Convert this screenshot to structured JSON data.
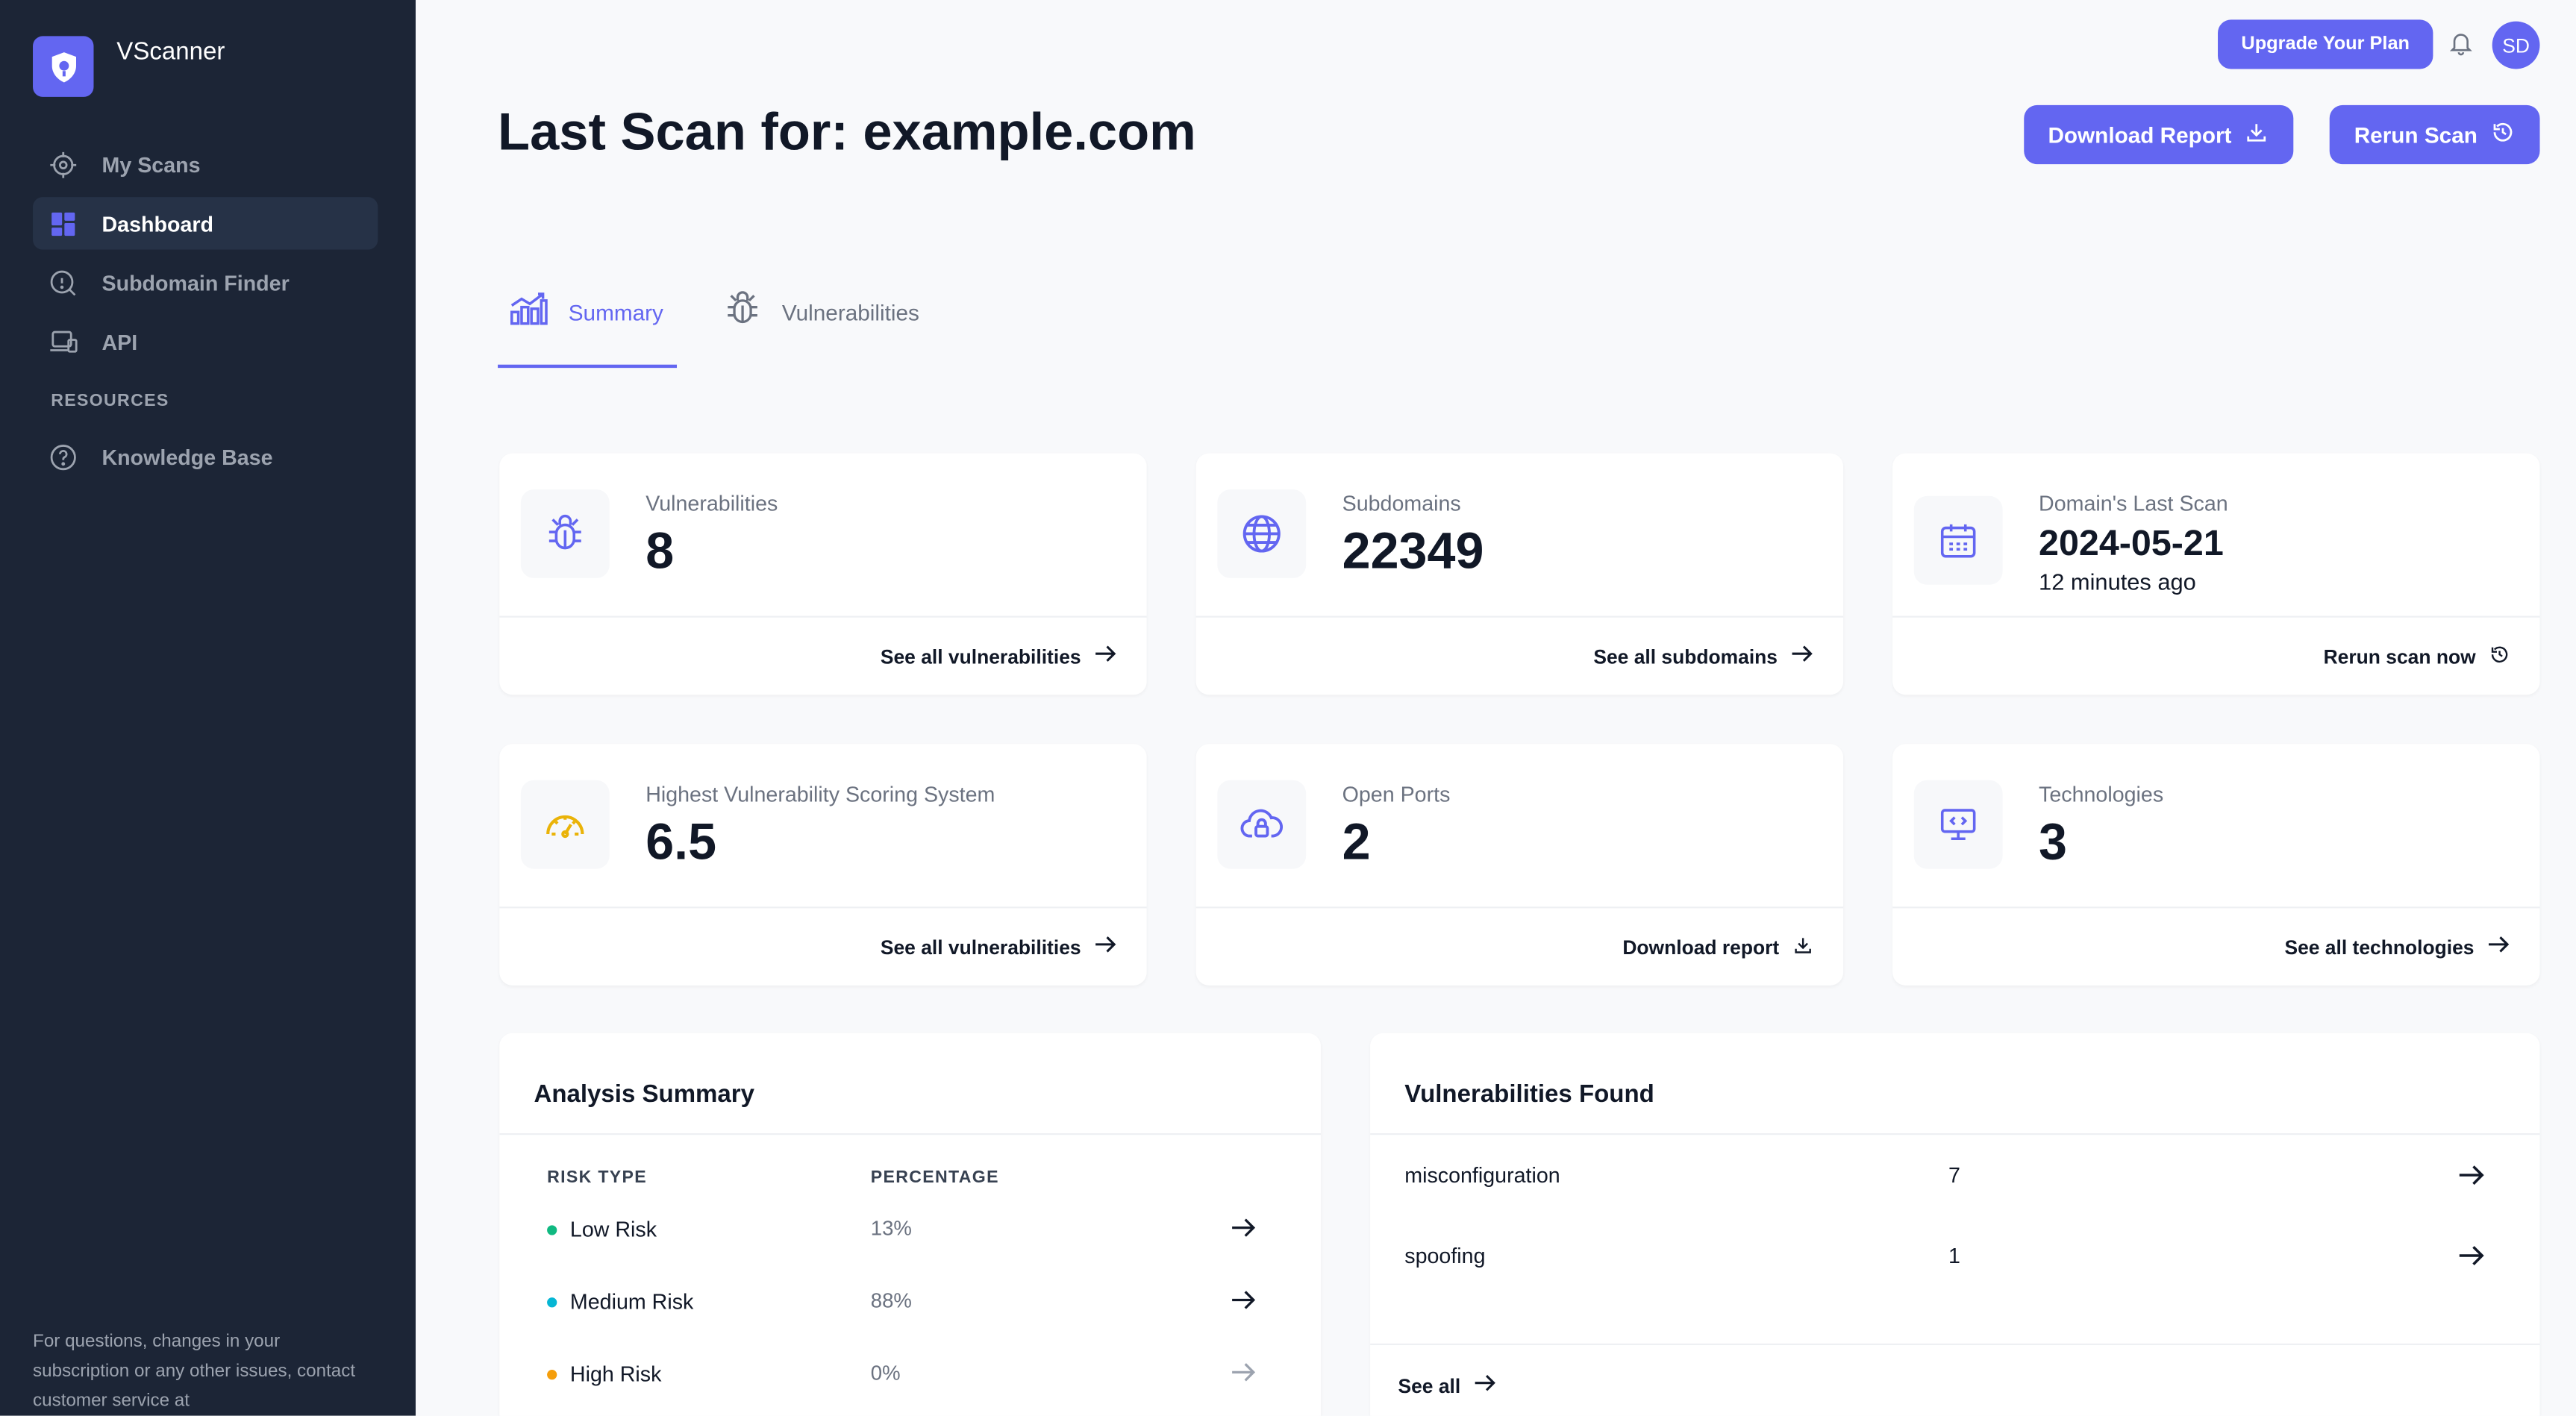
{
  "app": {
    "name": "VScanner"
  },
  "sidebar": {
    "items": [
      {
        "label": "My Scans",
        "icon": "crosshair-icon"
      },
      {
        "label": "Dashboard",
        "icon": "grid-icon"
      },
      {
        "label": "Subdomain Finder",
        "icon": "search-icon"
      },
      {
        "label": "API",
        "icon": "laptop-icon"
      }
    ],
    "resources_heading": "RESOURCES",
    "resources": [
      {
        "label": "Knowledge Base",
        "icon": "help-circle-icon"
      }
    ],
    "footer_text": "For questions, changes in your subscription or any other issues, contact customer service at"
  },
  "topbar": {
    "upgrade_label": "Upgrade Your Plan",
    "avatar_initials": "SD"
  },
  "header": {
    "title": "Last Scan for: example.com",
    "download_report_label": "Download Report",
    "rerun_scan_label": "Rerun Scan"
  },
  "tabs": [
    {
      "label": "Summary",
      "active": true
    },
    {
      "label": "Vulnerabilities",
      "active": false
    }
  ],
  "cards": [
    {
      "label": "Vulnerabilities",
      "value": "8",
      "link": "See all vulnerabilities",
      "icon": "bug-icon"
    },
    {
      "label": "Subdomains",
      "value": "22349",
      "link": "See all subdomains",
      "icon": "globe-icon"
    },
    {
      "label": "Domain's Last Scan",
      "value": "2024-05-21",
      "sub": "12 minutes ago",
      "link": "Rerun scan now",
      "icon": "calendar-icon"
    },
    {
      "label": "Highest Vulnerability Scoring System",
      "value": "6.5",
      "link": "See all vulnerabilities",
      "icon": "gauge-icon"
    },
    {
      "label": "Open Ports",
      "value": "2",
      "link": "Download report",
      "icon": "cloud-lock-icon"
    },
    {
      "label": "Technologies",
      "value": "3",
      "link": "See all technologies",
      "icon": "monitor-code-icon"
    }
  ],
  "analysis": {
    "title": "Analysis Summary",
    "col_risk": "RISK TYPE",
    "col_pct": "PERCENTAGE",
    "rows": [
      {
        "name": "Low Risk",
        "pct": "13%",
        "color": "#10b981"
      },
      {
        "name": "Medium Risk",
        "pct": "88%",
        "color": "#06b6d4"
      },
      {
        "name": "High Risk",
        "pct": "0%",
        "color": "#f59e0b"
      }
    ]
  },
  "vulns_found": {
    "title": "Vulnerabilities Found",
    "rows": [
      {
        "name": "misconfiguration",
        "count": "7"
      },
      {
        "name": "spoofing",
        "count": "1"
      }
    ],
    "see_all": "See all"
  },
  "colors": {
    "accent": "#6366f1",
    "sidebar_bg": "#1c2536",
    "gauge": "#eab308"
  }
}
